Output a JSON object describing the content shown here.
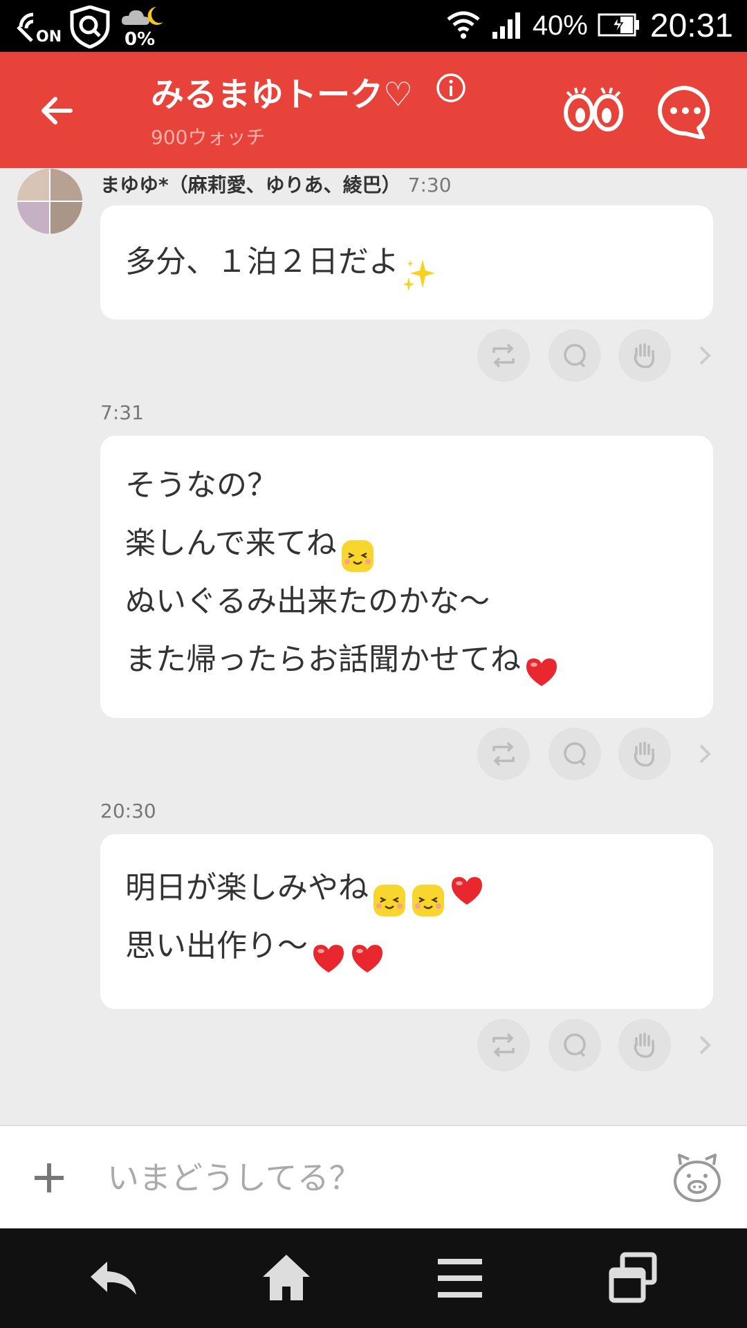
{
  "status_bar": {
    "weather_percent": "0%",
    "battery_percent": "40%",
    "time": "20:31",
    "nfc_label": "ON"
  },
  "header": {
    "title": "みるまゆトーク♡",
    "watch_count": "900ウォッチ",
    "accent_color": "#e8433a"
  },
  "messages": [
    {
      "sender": "まゆゆ*（麻莉愛、ゆりあ、綾巴）",
      "time": "7:30",
      "lines": [
        {
          "text": "多分、１泊２日だよ",
          "emojis": [
            "sparkles"
          ]
        }
      ]
    },
    {
      "time": "7:31",
      "lines": [
        {
          "text": "そうなの？",
          "emojis": []
        },
        {
          "text": "楽しんで来てね",
          "emojis": [
            "smile"
          ]
        },
        {
          "text": "ぬいぐるみ出来たのかな〜",
          "emojis": []
        },
        {
          "text": "また帰ったらお話聞かせてね",
          "emojis": [
            "heart"
          ]
        }
      ]
    },
    {
      "time": "20:30",
      "lines": [
        {
          "text": "明日が楽しみやね",
          "emojis": [
            "smile",
            "smile",
            "heart"
          ]
        },
        {
          "text": "思い出作り〜",
          "emojis": [
            "heart",
            "heart"
          ]
        }
      ]
    }
  ],
  "message_actions": [
    "repost-icon",
    "comment-icon",
    "cheer-hand-icon",
    "chevron-right-icon"
  ],
  "composer": {
    "placeholder": "いまどうしてる？"
  },
  "nav_bar": [
    "back-icon",
    "home-icon",
    "menu-icon",
    "recent-apps-icon"
  ]
}
